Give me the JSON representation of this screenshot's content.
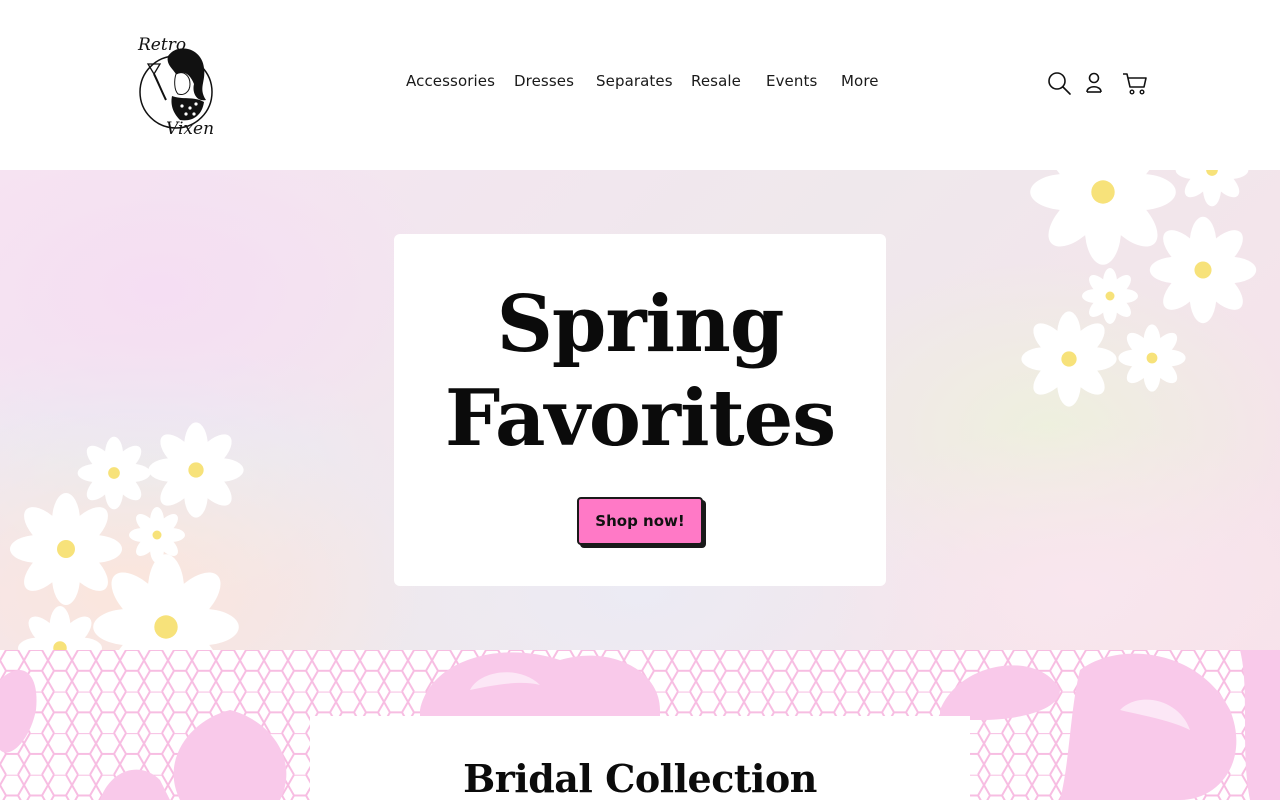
{
  "brand": {
    "logo_text_top": "Retro",
    "logo_text_bottom": "Vixen",
    "logo_icon": "pinup-girl-logo"
  },
  "nav": {
    "items": [
      {
        "label": "Accessories"
      },
      {
        "label": "Dresses"
      },
      {
        "label": "Separates"
      },
      {
        "label": "Resale"
      },
      {
        "label": "Events"
      },
      {
        "label": "More"
      }
    ]
  },
  "header_icons": {
    "search": "search-icon",
    "account": "user-icon",
    "cart": "cart-icon"
  },
  "hero": {
    "title": "Spring Favorites",
    "button_label": "Shop now!"
  },
  "bridal": {
    "title": "Bridal Collection"
  },
  "colors": {
    "accent": "#ff79c6",
    "text": "#0b0b0b",
    "pattern_pink": "#f9c9ea"
  }
}
